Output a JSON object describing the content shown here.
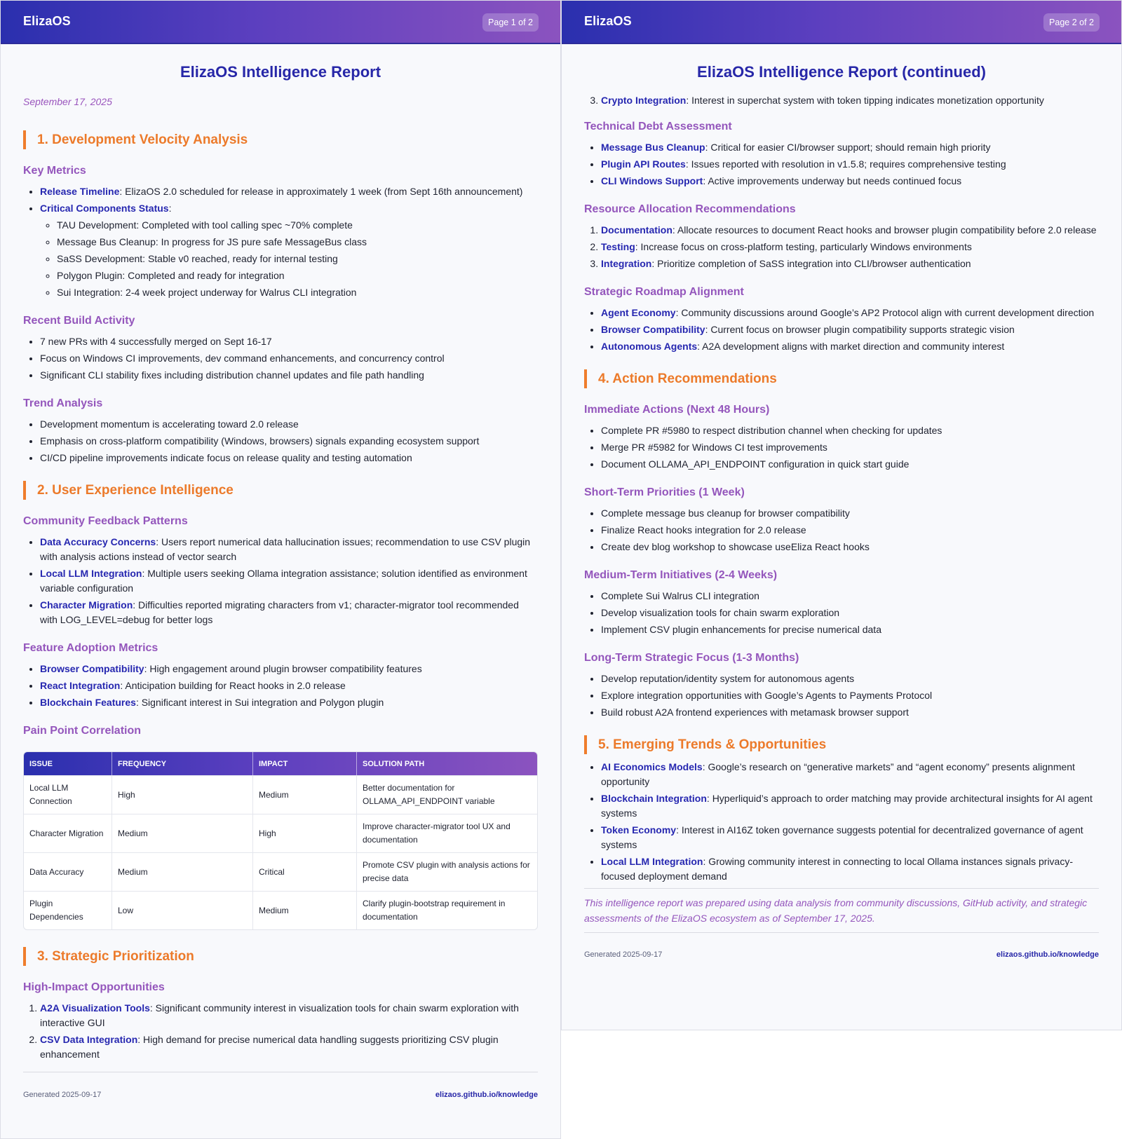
{
  "page1": {
    "brand": "ElizaOS",
    "badge": "Page 1 of 2",
    "title": "ElizaOS Intelligence Report",
    "date": "September 17, 2025",
    "s1": {
      "title": "1. Development Velocity Analysis",
      "key_metrics": "Key Metrics",
      "release_kw": "Release Timeline",
      "release_text": ": ElizaOS 2.0 scheduled for release in approximately 1 week (from Sept 16th announcement)",
      "critical_kw": "Critical Components Status",
      "critical_text": ":",
      "components": [
        "TAU Development: Completed with tool calling spec ~70% complete",
        "Message Bus Cleanup: In progress for JS pure safe MessageBus class",
        "SaSS Development: Stable v0 reached, ready for internal testing",
        "Polygon Plugin: Completed and ready for integration",
        "Sui Integration: 2-4 week project underway for Walrus CLI integration"
      ],
      "build_title": "Recent Build Activity",
      "build": [
        "7 new PRs with 4 successfully merged on Sept 16-17",
        "Focus on Windows CI improvements, dev command enhancements, and concurrency control",
        "Significant CLI stability fixes including distribution channel updates and file path handling"
      ],
      "trend_title": "Trend Analysis",
      "trend": [
        "Development momentum is accelerating toward 2.0 release",
        "Emphasis on cross-platform compatibility (Windows, browsers) signals expanding ecosystem support",
        "CI/CD pipeline improvements indicate focus on release quality and testing automation"
      ]
    },
    "s2": {
      "title": "2. User Experience Intelligence",
      "feedback_title": "Community Feedback Patterns",
      "feedback": [
        {
          "kw": "Data Accuracy Concerns",
          "text": ": Users report numerical data hallucination issues; recommendation to use CSV plugin with analysis actions instead of vector search"
        },
        {
          "kw": "Local LLM Integration",
          "text": ": Multiple users seeking Ollama integration assistance; solution identified as environment variable configuration"
        },
        {
          "kw": "Character Migration",
          "text": ": Difficulties reported migrating characters from v1; character-migrator tool recommended with LOG_LEVEL=debug for better logs"
        }
      ],
      "adoption_title": "Feature Adoption Metrics",
      "adoption": [
        {
          "kw": "Browser Compatibility",
          "text": ": High engagement around plugin browser compatibility features"
        },
        {
          "kw": "React Integration",
          "text": ": Anticipation building for React hooks in 2.0 release"
        },
        {
          "kw": "Blockchain Features",
          "text": ": Significant interest in Sui integration and Polygon plugin"
        }
      ],
      "pain_title": "Pain Point Correlation",
      "table": {
        "headers": [
          "ISSUE",
          "FREQUENCY",
          "IMPACT",
          "SOLUTION PATH"
        ],
        "rows": [
          [
            "Local LLM Connection",
            "High",
            "Medium",
            "Better documentation for OLLAMA_API_ENDPOINT variable"
          ],
          [
            "Character Migration",
            "Medium",
            "High",
            "Improve character-migrator tool UX and documentation"
          ],
          [
            "Data Accuracy",
            "Medium",
            "Critical",
            "Promote CSV plugin with analysis actions for precise data"
          ],
          [
            "Plugin Dependencies",
            "Low",
            "Medium",
            "Clarify plugin-bootstrap requirement in documentation"
          ]
        ]
      }
    },
    "s3": {
      "title": "3. Strategic Prioritization",
      "hi_title": "High-Impact Opportunities",
      "hi": [
        {
          "kw": "A2A Visualization Tools",
          "text": ": Significant community interest in visualization tools for chain swarm exploration with interactive GUI"
        },
        {
          "kw": "CSV Data Integration",
          "text": ": High demand for precise numerical data handling suggests prioritizing CSV plugin enhancement"
        }
      ]
    },
    "footer_left": "Generated 2025-09-17",
    "footer_right": "elizaos.github.io/knowledge"
  },
  "page2": {
    "brand": "ElizaOS",
    "badge": "Page 2 of 2",
    "title": "ElizaOS Intelligence Report (continued)",
    "hi3": {
      "kw": "Crypto Integration",
      "text": ": Interest in superchat system with token tipping indicates monetization opportunity"
    },
    "debt_title": "Technical Debt Assessment",
    "debt": [
      {
        "kw": "Message Bus Cleanup",
        "text": ": Critical for easier CI/browser support; should remain high priority"
      },
      {
        "kw": "Plugin API Routes",
        "text": ": Issues reported with resolution in v1.5.8; requires comprehensive testing"
      },
      {
        "kw": "CLI Windows Support",
        "text": ": Active improvements underway but needs continued focus"
      }
    ],
    "resource_title": "Resource Allocation Recommendations",
    "resource": [
      {
        "kw": "Documentation",
        "text": ": Allocate resources to document React hooks and browser plugin compatibility before 2.0 release"
      },
      {
        "kw": "Testing",
        "text": ": Increase focus on cross-platform testing, particularly Windows environments"
      },
      {
        "kw": "Integration",
        "text": ": Prioritize completion of SaSS integration into CLI/browser authentication"
      }
    ],
    "roadmap_title": "Strategic Roadmap Alignment",
    "roadmap": [
      {
        "kw": "Agent Economy",
        "text": ": Community discussions around Google’s AP2 Protocol align with current development direction"
      },
      {
        "kw": "Browser Compatibility",
        "text": ": Current focus on browser plugin compatibility supports strategic vision"
      },
      {
        "kw": "Autonomous Agents",
        "text": ": A2A development aligns with market direction and community interest"
      }
    ],
    "s4": {
      "title": "4. Action Recommendations",
      "immediate_title": "Immediate Actions (Next 48 Hours)",
      "immediate": [
        "Complete PR #5980 to respect distribution channel when checking for updates",
        "Merge PR #5982 for Windows CI test improvements",
        "Document OLLAMA_API_ENDPOINT configuration in quick start guide"
      ],
      "short_title": "Short-Term Priorities (1 Week)",
      "short": [
        "Complete message bus cleanup for browser compatibility",
        "Finalize React hooks integration for 2.0 release",
        "Create dev blog workshop to showcase useEliza React hooks"
      ],
      "medium_title": "Medium-Term Initiatives (2-4 Weeks)",
      "medium": [
        "Complete Sui Walrus CLI integration",
        "Develop visualization tools for chain swarm exploration",
        "Implement CSV plugin enhancements for precise numerical data"
      ],
      "long_title": "Long-Term Strategic Focus (1-3 Months)",
      "long": [
        "Develop reputation/identity system for autonomous agents",
        "Explore integration opportunities with Google’s Agents to Payments Protocol",
        "Build robust A2A frontend experiences with metamask browser support"
      ]
    },
    "s5": {
      "title": "5. Emerging Trends & Opportunities",
      "items": [
        {
          "kw": "AI Economics Models",
          "text": ": Google’s research on “generative markets” and “agent economy” presents alignment opportunity"
        },
        {
          "kw": "Blockchain Integration",
          "text": ": Hyperliquid’s approach to order matching may provide architectural insights for AI agent systems"
        },
        {
          "kw": "Token Economy",
          "text": ": Interest in AI16Z token governance suggests potential for decentralized governance of agent systems"
        },
        {
          "kw": "Local LLM Integration",
          "text": ": Growing community interest in connecting to local Ollama instances signals privacy-focused deployment demand"
        }
      ]
    },
    "closing_note": "This intelligence report was prepared using data analysis from community discussions, GitHub activity, and strategic assessments of the ElizaOS ecosystem as of September 17, 2025.",
    "footer_left": "Generated 2025-09-17",
    "footer_right": "elizaos.github.io/knowledge"
  }
}
